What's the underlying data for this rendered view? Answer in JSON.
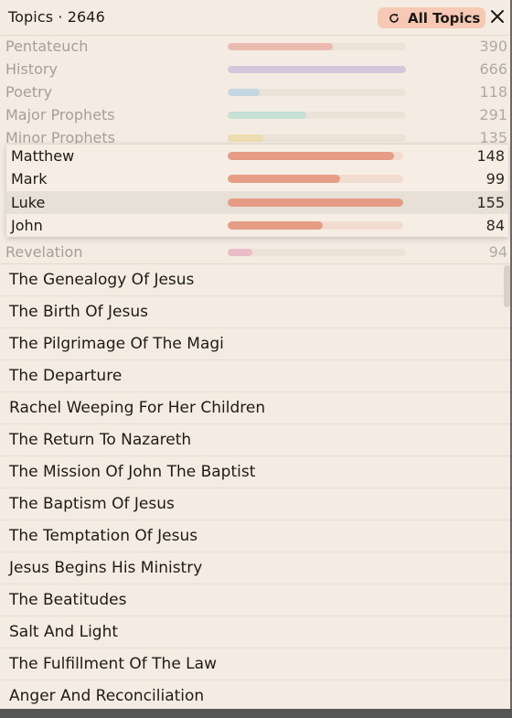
{
  "header": {
    "title": "Topics · 2646",
    "all_topics_label": "All Topics",
    "refresh_icon": "refresh-icon",
    "close_icon": "close-icon"
  },
  "categories": [
    {
      "label": "Pentateuch",
      "count": "390",
      "fraction": 0.59,
      "color": "#ebbbb0"
    },
    {
      "label": "History",
      "count": "666",
      "fraction": 1.0,
      "color": "#d6c6dc"
    },
    {
      "label": "Poetry",
      "count": "118",
      "fraction": 0.18,
      "color": "#c6d6e1"
    },
    {
      "label": "Major Prophets",
      "count": "291",
      "fraction": 0.44,
      "color": "#c6e0d6"
    },
    {
      "label": "Minor Prophets",
      "count": "135",
      "fraction": 0.2,
      "color": "#eedcb0"
    },
    {
      "label": "Revelation",
      "count": "94",
      "fraction": 0.14,
      "color": "#e9bcc6"
    }
  ],
  "books": [
    {
      "label": "Matthew",
      "count": "148",
      "fraction": 0.95,
      "selected": false
    },
    {
      "label": "Mark",
      "count": "99",
      "fraction": 0.64,
      "selected": false
    },
    {
      "label": "Luke",
      "count": "155",
      "fraction": 1.0,
      "selected": true
    },
    {
      "label": "John",
      "count": "84",
      "fraction": 0.54,
      "selected": false
    }
  ],
  "topics": [
    "The Genealogy Of Jesus",
    "The Birth Of Jesus",
    "The Pilgrimage Of The Magi",
    "The Departure",
    "Rachel Weeping For Her Children",
    "The Return To Nazareth",
    "The Mission Of John The Baptist",
    "The Baptism Of Jesus",
    "The Temptation Of Jesus",
    "Jesus Begins His Ministry",
    "The Beatitudes",
    "Salt And Light",
    "The Fulfillment Of The Law",
    "Anger And Reconciliation"
  ]
}
